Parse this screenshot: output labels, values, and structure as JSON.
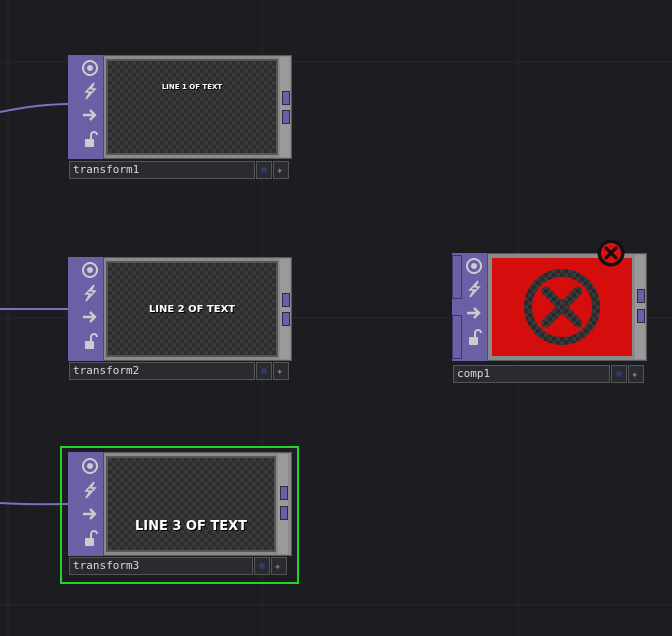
{
  "nodes": [
    {
      "name": "transform1",
      "viewer_text": "LINE 1 OF TEXT",
      "selected": false,
      "error": false
    },
    {
      "name": "transform2",
      "viewer_text": "LINE 2 OF TEXT",
      "selected": false,
      "error": false
    },
    {
      "name": "transform3",
      "viewer_text": "LINE 3 OF TEXT",
      "selected": true,
      "error": false
    },
    {
      "name": "comp1",
      "viewer_text": "",
      "selected": false,
      "error": true
    }
  ],
  "colors": {
    "background": "#1c1d21",
    "node_sidebar": "#6b5fa6",
    "wire": "#7b6fc0",
    "selection": "#22d32a",
    "error": "#d40e0e"
  },
  "icons": [
    "viewer-toggle-icon",
    "cook-bolt-icon",
    "arrow-right-icon",
    "lock-icon",
    "error-x-icon"
  ]
}
